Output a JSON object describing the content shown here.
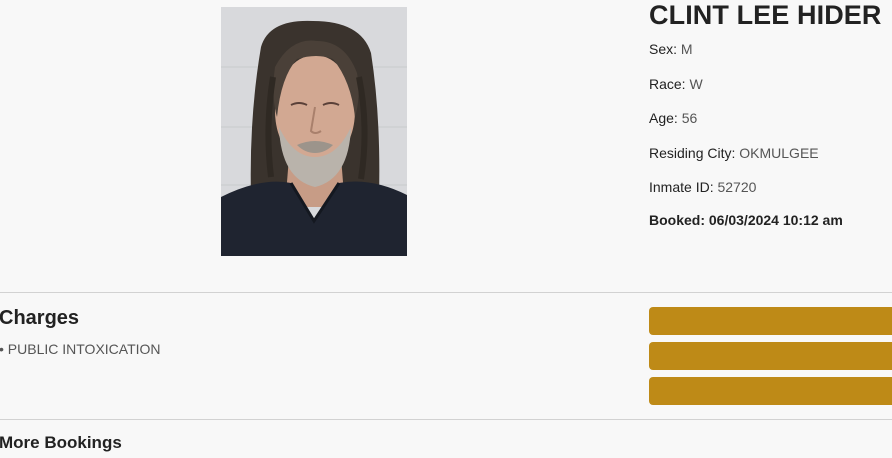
{
  "inmate": {
    "name": "CLINT LEE HIDER",
    "photo_alt": "mugshot",
    "fields": [
      {
        "label": "Sex:",
        "value": "M"
      },
      {
        "label": "Race:",
        "value": "W"
      },
      {
        "label": "Age:",
        "value": "56"
      },
      {
        "label": "Residing City:",
        "value": "OKMULGEE"
      },
      {
        "label": "Inmate ID:",
        "value": "52720"
      }
    ],
    "booked_label": "Booked:",
    "booked_value": "06/03/2024 10:12 am"
  },
  "charges": {
    "title": "Charges",
    "items": [
      "• PUBLIC INTOXICATION"
    ]
  },
  "action_buttons": [
    {
      "label": ""
    },
    {
      "label": ""
    },
    {
      "label": ""
    }
  ],
  "more_bookings": {
    "title": "More Bookings"
  },
  "colors": {
    "button_gold": "#be8a17",
    "background": "#f8f8f8",
    "divider": "#d2d2d2"
  }
}
